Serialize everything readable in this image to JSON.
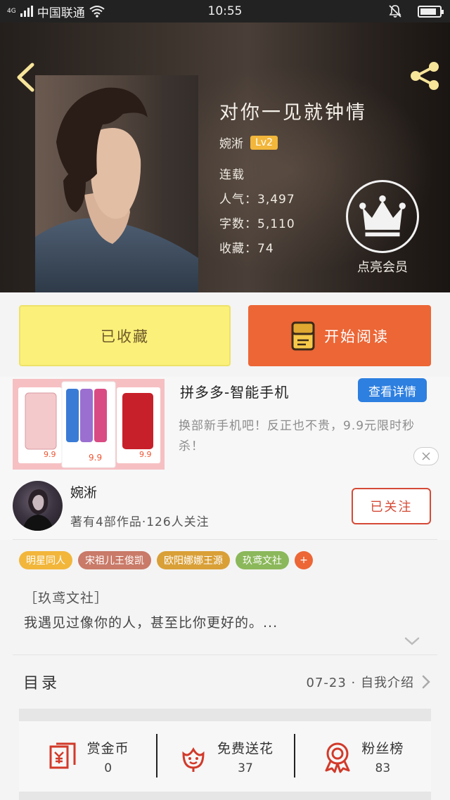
{
  "status_bar": {
    "network": "4G",
    "carrier": "中国联通",
    "time": "10:55",
    "battery_level": 0.85
  },
  "header": {
    "back_icon": "chevron-left-icon",
    "share_icon": "share-icon"
  },
  "book": {
    "title": "对你一见就钟情",
    "author": "婉淅",
    "level": "Lv2",
    "status": "连载",
    "popularity": "人气：3,497",
    "word_count": "字数：5,110",
    "favorites": "收藏：74"
  },
  "vip": {
    "icon": "crown-icon",
    "label": "点亮会员"
  },
  "actions": {
    "collected_label": "已收藏",
    "read_label": "开始阅读",
    "read_icon": "book-icon"
  },
  "ad": {
    "title": "拼多多-智能手机",
    "button": "查看详情",
    "description": "换部新手机吧！反正也不贵，9.9元限时秒杀！",
    "price": "9.9",
    "close_icon": "close-icon"
  },
  "author_section": {
    "name": "婉淅",
    "stats": "著有4部作品·126人关注",
    "follow_label": "已关注"
  },
  "tags": [
    {
      "label": "明星同人",
      "color": "#f2b63b"
    },
    {
      "label": "宋祖儿王俊凯",
      "color": "#c97a68"
    },
    {
      "label": "欧阳娜娜王源",
      "color": "#d9a038"
    },
    {
      "label": "玖鸢文社",
      "color": "#8bb85a"
    },
    {
      "label": "+",
      "color": "#ec6636"
    }
  ],
  "intro": {
    "tag_line": "［玖鸢文社］",
    "text": "我遇见过像你的人，甚至比你更好的。..."
  },
  "toc": {
    "label": "目录",
    "latest": "07-23 · 自我介绍"
  },
  "gifts": [
    {
      "label": "赏金币",
      "count": "0",
      "icon": "red-envelope-icon"
    },
    {
      "label": "免费送花",
      "count": "37",
      "icon": "flower-icon"
    },
    {
      "label": "粉丝榜",
      "count": "83",
      "icon": "medal-icon"
    }
  ],
  "colors": {
    "accent_orange": "#ec6636",
    "collected_yellow": "#fbf07a",
    "follow_red": "#d44a36",
    "ad_blue": "#2d7fe0",
    "icon_red": "#d23a2a"
  }
}
